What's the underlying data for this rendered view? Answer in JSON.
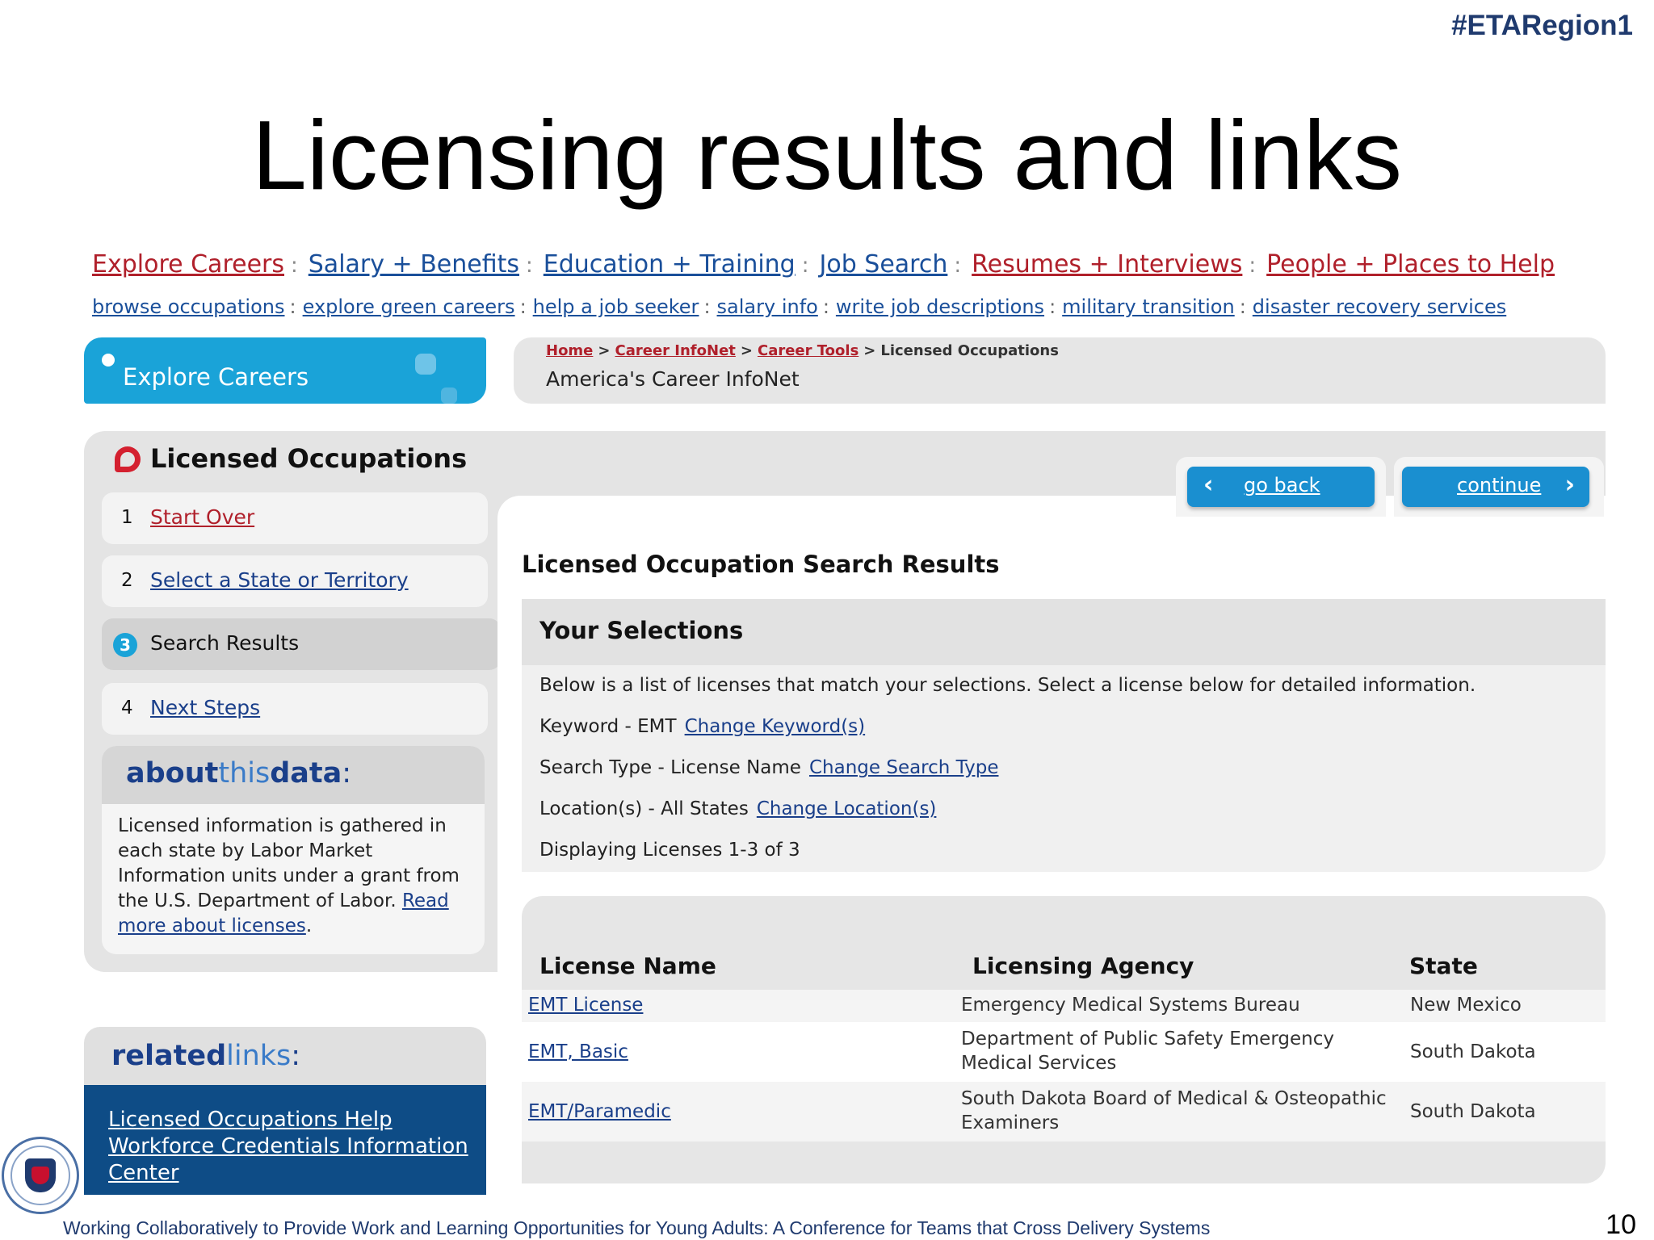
{
  "slide": {
    "hashtag": "#ETARegion1",
    "title": "Licensing results and links",
    "footer": "Working Collaboratively to Provide Work and Learning Opportunities for Young Adults: A Conference for Teams that Cross Delivery Systems",
    "page_number": "10"
  },
  "nav_primary": [
    {
      "label": "Explore Careers",
      "color": "#b0202b"
    },
    {
      "label": "Salary + Benefits",
      "color": "#1a4f9a"
    },
    {
      "label": "Education + Training",
      "color": "#1a4f9a"
    },
    {
      "label": "Job Search",
      "color": "#1a4f9a"
    },
    {
      "label": "Resumes + Interviews",
      "color": "#b0202b"
    },
    {
      "label": "People + Places to Help",
      "color": "#b0202b"
    }
  ],
  "nav_secondary": [
    "browse occupations",
    "explore green careers",
    "help a job seeker",
    "salary info",
    "write job descriptions",
    "military transition",
    "disaster recovery services"
  ],
  "section_tab": "Explore Careers",
  "breadcrumb": {
    "home": "Home",
    "career_infonet": "Career InfoNet",
    "career_tools": "Career Tools",
    "current": "Licensed Occupations",
    "subtitle": "America's Career InfoNet"
  },
  "tool_title": "Licensed Occupations",
  "steps": [
    {
      "number": "1",
      "label": "Start Over"
    },
    {
      "number": "2",
      "label": "Select a State or Territory"
    },
    {
      "number": "3",
      "label": "Search Results"
    },
    {
      "number": "4",
      "label": "Next Steps"
    }
  ],
  "about": {
    "title_bold": "about",
    "title_thin": "this",
    "title_bold2": "data",
    "colon": ":",
    "text": "Licensed information is gathered in each state by Labor Market Information units under a grant from the U.S. Department of Labor.",
    "read_more": "Read more about licenses",
    "end": "."
  },
  "buttons": {
    "go_back": "go back",
    "continue": "continue"
  },
  "results": {
    "title": "Licensed Occupation Search Results",
    "selections_title": "Your Selections",
    "intro": "Below is a list of licenses that match your selections. Select a license below for detailed information.",
    "keyword_label": "Keyword - EMT",
    "keyword_link": "Change Keyword(s)",
    "search_type_label": "Search Type - License Name",
    "search_type_link": "Change Search Type",
    "location_label": "Location(s) - All States",
    "location_link": "Change Location(s)",
    "displaying": "Displaying Licenses 1-3 of 3"
  },
  "table": {
    "headers": [
      "License Name",
      "Licensing Agency",
      "State"
    ],
    "rows": [
      {
        "name": "EMT License",
        "agency": "Emergency Medical Systems Bureau",
        "state": "New Mexico"
      },
      {
        "name": "EMT, Basic",
        "agency": "Department of Public Safety Emergency Medical Services",
        "state": "South Dakota"
      },
      {
        "name": "EMT/Paramedic",
        "agency": "South Dakota Board of Medical & Osteopathic Examiners",
        "state": "South Dakota"
      }
    ]
  },
  "related": {
    "title_bold": "related",
    "title_thin": "links",
    "colon": ":",
    "links": [
      "Licensed Occupations Help",
      "Workforce Credentials Information",
      "Center"
    ]
  },
  "colors": {
    "accent_blue": "#1aa3d8",
    "link_red": "#b0202b",
    "link_blue": "#1a3f8a",
    "related_bg": "#0e4c86"
  }
}
